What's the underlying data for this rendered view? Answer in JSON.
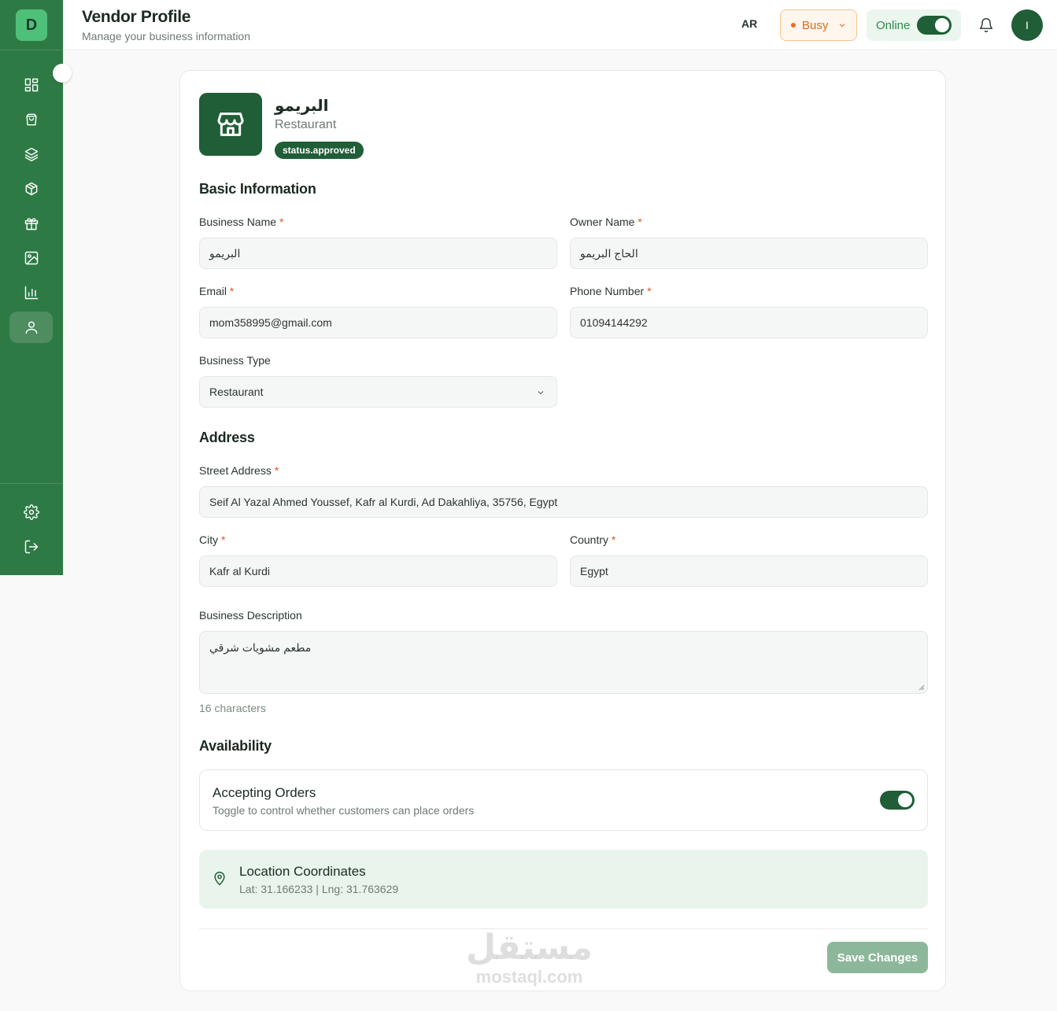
{
  "sidebar": {
    "logo_letter": "D",
    "items": [
      {
        "icon": "dashboard-grid-icon"
      },
      {
        "icon": "shopping-bag-icon"
      },
      {
        "icon": "layers-icon"
      },
      {
        "icon": "package-box-icon"
      },
      {
        "icon": "gift-icon"
      },
      {
        "icon": "image-icon"
      },
      {
        "icon": "bar-chart-icon"
      },
      {
        "icon": "user-icon",
        "active": true
      }
    ],
    "bottom_items": [
      {
        "icon": "settings-gear-icon"
      },
      {
        "icon": "logout-icon"
      }
    ]
  },
  "header": {
    "title": "Vendor Profile",
    "subtitle": "Manage your business information",
    "language": "AR",
    "busy_status": "Busy",
    "online_label": "Online",
    "online_on": true,
    "avatar_initial": "I"
  },
  "profile": {
    "name": "البريمو",
    "type": "Restaurant",
    "status_badge": "status.approved"
  },
  "basic_info": {
    "section_title": "Basic Information",
    "business_name_label": "Business Name",
    "business_name_value": "البريمو",
    "owner_name_label": "Owner Name",
    "owner_name_value": "الحاج البريمو",
    "email_label": "Email",
    "email_value": "mom358995@gmail.com",
    "phone_label": "Phone Number",
    "phone_value": "01094144292",
    "business_type_label": "Business Type",
    "business_type_value": "Restaurant",
    "required_mark": "*"
  },
  "address": {
    "section_title": "Address",
    "street_label": "Street Address",
    "street_value": "Seif Al Yazal Ahmed Youssef, Kafr al Kurdi, Ad Dakahliya, 35756, Egypt",
    "city_label": "City",
    "city_value": "Kafr al Kurdi",
    "country_label": "Country",
    "country_value": "Egypt",
    "description_label": "Business Description",
    "description_value": "مطعم مشويات شرقي",
    "char_count": "16 characters"
  },
  "availability": {
    "section_title": "Availability",
    "accepting_title": "Accepting Orders",
    "accepting_desc": "Toggle to control whether customers can place orders",
    "accepting_on": true
  },
  "location": {
    "title": "Location Coordinates",
    "value": "Lat: 31.166233 | Lng: 31.763629"
  },
  "actions": {
    "save_label": "Save Changes"
  },
  "watermark": {
    "arabic": "مستقل",
    "latin": "mostaql.com"
  },
  "colors": {
    "primary": "#1f5e36",
    "sidebar": "#2e7a45",
    "busy": "#e06a1c",
    "required": "#e0552f"
  }
}
